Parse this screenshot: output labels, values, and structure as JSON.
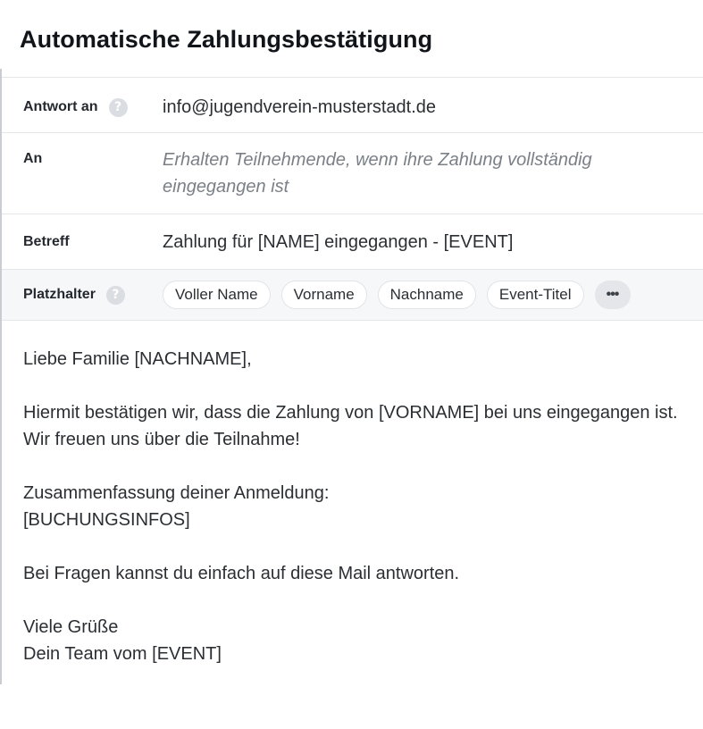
{
  "title": "Automatische Zahlungsbestätigung",
  "fields": {
    "reply_to": {
      "label": "Antwort an",
      "help": "?",
      "value": "info@jugendverein-musterstadt.de"
    },
    "to": {
      "label": "An",
      "value": "Erhalten Teilnehmende, wenn ihre Zahlung vollständig eingegangen ist"
    },
    "subject": {
      "label": "Betreff",
      "value": "Zahlung für [NAME] eingegangen - [EVENT]"
    },
    "placeholders": {
      "label": "Platzhalter",
      "help": "?",
      "chips": [
        "Voller Name",
        "Vorname",
        "Nachname",
        "Event-Titel"
      ],
      "more": "•••"
    }
  },
  "body": {
    "lines": [
      "Liebe Familie [NACHNAME],",
      "",
      "Hiermit bestätigen wir, dass die Zahlung von [VORNAME] bei uns eingegangen ist. Wir freuen uns über die Teilnahme!",
      "",
      "Zusammenfassung deiner Anmeldung:",
      "[BUCHUNGSINFOS]",
      "",
      "Bei Fragen kannst du einfach auf diese Mail antworten.",
      "",
      "Viele Grüße",
      "Dein Team vom [EVENT]"
    ]
  },
  "colors": {
    "text": "#2b2f33",
    "placeholder_text": "#7b8087",
    "row_gray": "#f6f7f9",
    "border": "#e4e6e9",
    "help_icon": "#dadde1"
  }
}
